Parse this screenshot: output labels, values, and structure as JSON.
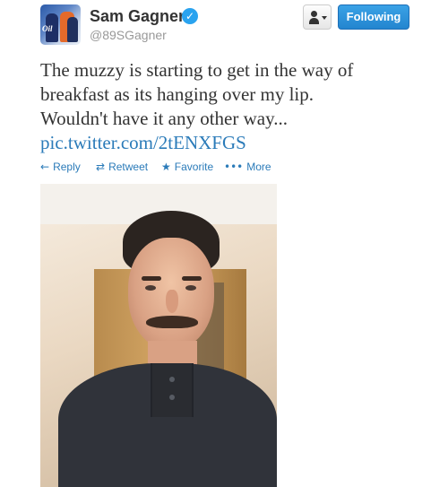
{
  "user": {
    "name": "Sam Gagner",
    "handle": "@89SGagner",
    "verified_mark": "✓"
  },
  "header": {
    "follow_label": "Following",
    "user_menu_icon": "person-dropdown-icon"
  },
  "tweet": {
    "text_lines": [
      "The muzzy is starting to get in the way of",
      "breakfast as its hanging over my lip.",
      "Wouldn't have it any other way..."
    ],
    "link": "pic.twitter.com/2tENXFGS"
  },
  "actions": [
    {
      "label": "Reply",
      "icon": "reply-icon",
      "glyph": "←"
    },
    {
      "label": "Retweet",
      "icon": "retweet-icon",
      "glyph": "⇄"
    },
    {
      "label": "Favorite",
      "icon": "star-icon",
      "glyph": "★"
    },
    {
      "label": "More",
      "icon": "more-icon",
      "glyph": "•••"
    }
  ],
  "colors": {
    "link": "#2b7bb9",
    "follow_button": "#2385cf",
    "verified": "#2aa3ef",
    "handle": "#999999"
  }
}
